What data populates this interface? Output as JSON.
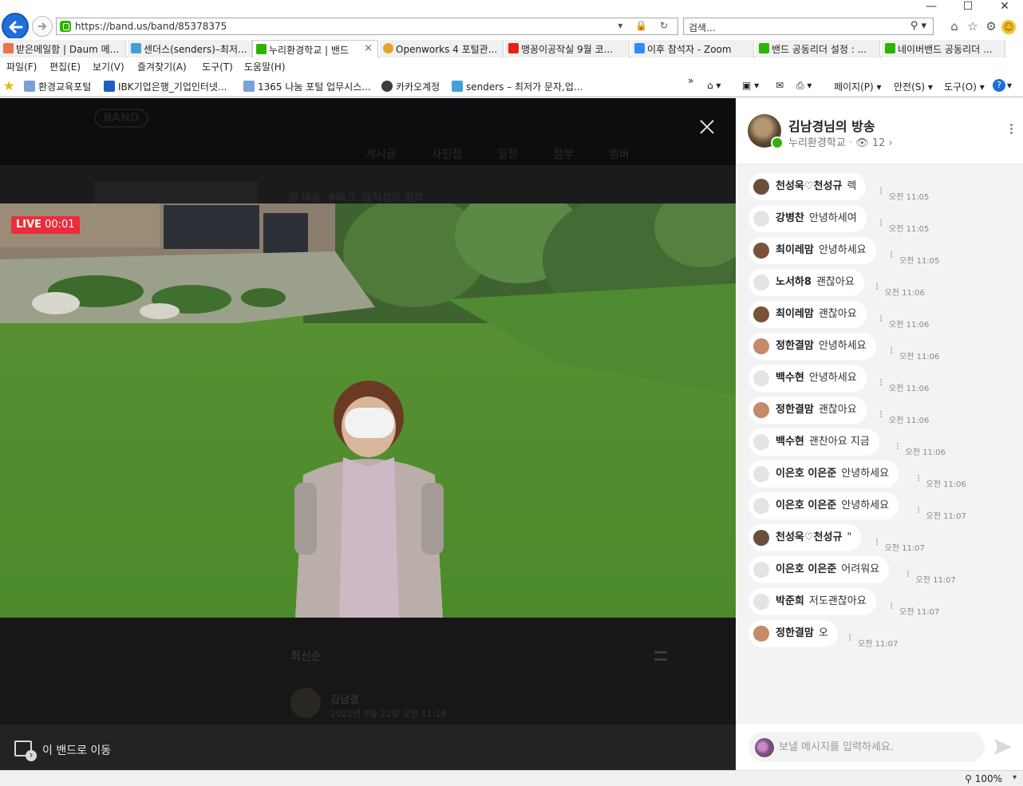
{
  "browser": {
    "url": "https://band.us/band/85378375",
    "search_placeholder": "검색...",
    "tabs": [
      {
        "label": "받은메일함 | Daum 메...",
        "color": "#e9734f"
      },
      {
        "label": "센더스(senders)–최저...",
        "color": "#41a0d6"
      },
      {
        "label": "누리환경학교 | 밴드",
        "color": "#2db400",
        "active": true
      },
      {
        "label": "Openworks 4 포털관...",
        "color": "#e3a52a"
      },
      {
        "label": "맹꽁이공작실 9월 코...",
        "color": "#e62117"
      },
      {
        "label": "이후 참석자 - Zoom",
        "color": "#2d8cff"
      },
      {
        "label": "밴드 공동리더 설정 : ...",
        "color": "#2db400"
      },
      {
        "label": "네이버밴드 공동리더 ...",
        "color": "#2db400"
      }
    ],
    "menu": [
      "파일(F)",
      "편집(E)",
      "보기(V)",
      "즐겨찾기(A)",
      "도구(T)",
      "도움말(H)"
    ],
    "favorites": [
      {
        "label": "환경교육포털",
        "color": "#7aa0d8"
      },
      {
        "label": "IBK기업은행_기업인터넷...",
        "color": "#1f5fbf"
      },
      {
        "label": "1365 나눔 포털 업무시스...",
        "color": "#7aa0d8"
      },
      {
        "label": "카카오계정",
        "color": "#3c3c3c"
      },
      {
        "label": "senders – 최저가 문자,업...",
        "color": "#41a0d6"
      }
    ],
    "commands": [
      "페이지(P)",
      "안전(S)",
      "도구(O)"
    ],
    "zoom": "100%"
  },
  "background_page": {
    "logo": "BAND",
    "tabs": [
      "게시글",
      "사진첩",
      "일정",
      "첨부",
      "멤버"
    ],
    "search_text": "글 내용, #태그, @작성자 검색",
    "sort": "최신순",
    "post_author": "김남경",
    "post_date": "2021년 9월 22일 오전 11:18"
  },
  "live": {
    "badge_live": "LIVE",
    "badge_time": "00:01",
    "goto_band": "이 밴드로 이동"
  },
  "chat": {
    "title": "김남경님의 방송",
    "band_name": "누리환경학교",
    "viewers": "12",
    "input_placeholder": "보낼 메시지를 입력하세요.",
    "messages": [
      {
        "name": "천성욱♡천성규",
        "text": "렉",
        "time": "오전 11:05",
        "avatar": "#6b4d3c"
      },
      {
        "name": "강병찬",
        "text": "안녕하세여",
        "time": "오전 11:05",
        "avatar": "#e4e4e4"
      },
      {
        "name": "최이레맘",
        "text": "안녕하세요",
        "time": "오전 11:05",
        "avatar": "#7a5238"
      },
      {
        "name": "노서하8",
        "text": "괜찮아요",
        "time": "오전 11:06",
        "avatar": "#e4e4e4"
      },
      {
        "name": "최이레맘",
        "text": "괜찮아요",
        "time": "오전 11:06",
        "avatar": "#7a5238"
      },
      {
        "name": "정한결맘",
        "text": "안녕하세요",
        "time": "오전 11:06",
        "avatar": "#c48a6a"
      },
      {
        "name": "백수현",
        "text": "안녕하세요",
        "time": "오전 11:06",
        "avatar": "#e4e4e4"
      },
      {
        "name": "정한결맘",
        "text": "괜찮아요",
        "time": "오전 11:06",
        "avatar": "#c48a6a"
      },
      {
        "name": "백수현",
        "text": "괜찬아요 지금",
        "time": "오전 11:06",
        "avatar": "#e4e4e4"
      },
      {
        "name": "이은호 이은준",
        "text": "안녕하세요",
        "time": "오전 11:06",
        "avatar": "#e4e4e4"
      },
      {
        "name": "이은호 이은준",
        "text": "안녕하세요",
        "time": "오전 11:07",
        "avatar": "#e4e4e4"
      },
      {
        "name": "천성욱♡천성규",
        "text": "\"",
        "time": "오전 11:07",
        "avatar": "#6b4d3c"
      },
      {
        "name": "이은호 이은준",
        "text": "어려워요",
        "time": "오전 11:07",
        "avatar": "#e4e4e4"
      },
      {
        "name": "박준희",
        "text": "저도괜찮아요",
        "time": "오전 11:07",
        "avatar": "#e4e4e4"
      },
      {
        "name": "정한결맘",
        "text": "오",
        "time": "오전 11:07",
        "avatar": "#c48a6a"
      }
    ]
  }
}
